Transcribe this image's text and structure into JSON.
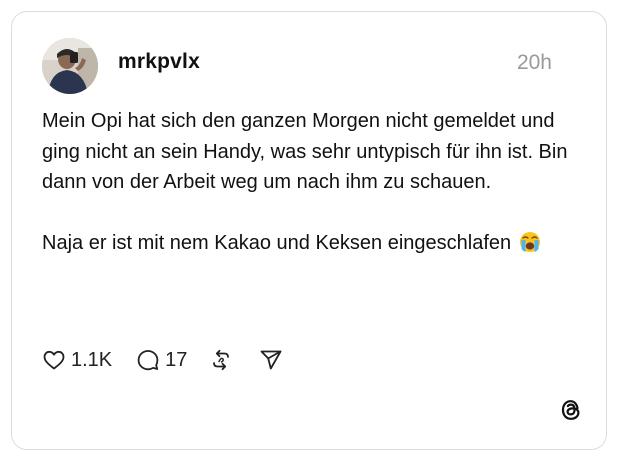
{
  "post": {
    "username": "mrkpvlx",
    "time": "20h",
    "paragraph_1": "Mein Opi hat sich den ganzen Morgen nicht gemeldet und ging nicht an sein Handy, was sehr untypisch für ihn ist. Bin dann von der Arbeit weg um nach ihm zu schauen.",
    "paragraph_2": "Naja er ist mit nem Kakao und Keksen eingeschlafen",
    "emoji": "loudly-crying-face"
  },
  "actions": {
    "likes": "1.1K",
    "replies": "17",
    "icons": [
      "heart-icon",
      "reply-bubble-icon",
      "repost-icon",
      "share-send-icon"
    ]
  },
  "branding": {
    "logo": "threads-logo-icon"
  },
  "colors": {
    "text": "#111111",
    "muted": "#9a9a9a",
    "border": "#dcdcdc"
  }
}
